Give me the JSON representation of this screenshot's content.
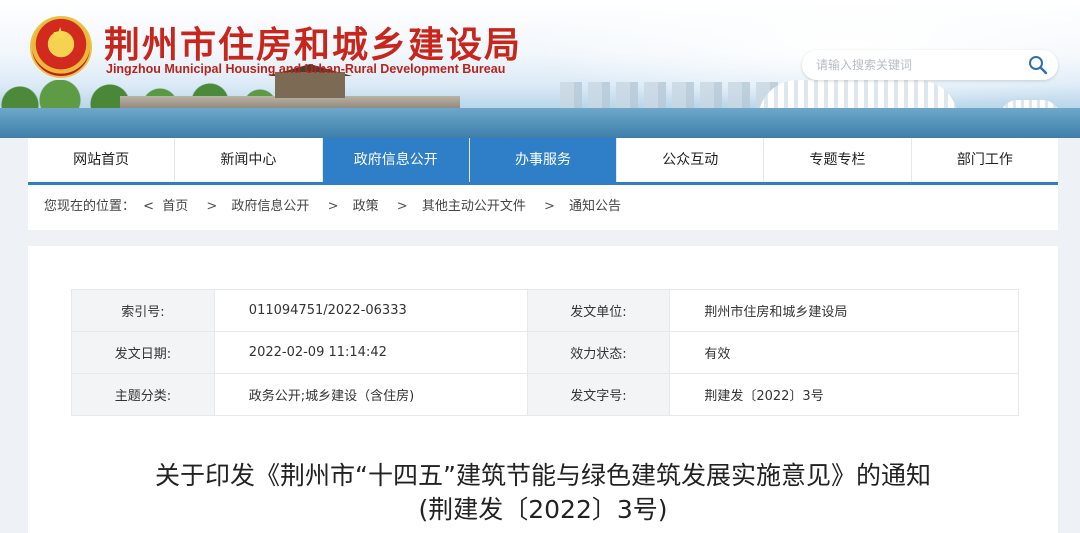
{
  "header": {
    "title_cn": "荆州市住房和城乡建设局",
    "title_en": "Jingzhou Municipal Housing and Urban-Rural Development Bureau",
    "emblem_icon": "national-emblem-icon",
    "search": {
      "placeholder": "请输入搜索关键词",
      "icon": "search-icon"
    }
  },
  "nav": {
    "items": [
      {
        "label": "网站首页",
        "active": false
      },
      {
        "label": "新闻中心",
        "active": false
      },
      {
        "label": "政府信息公开",
        "active": true
      },
      {
        "label": "办事服务",
        "active": true
      },
      {
        "label": "公众互动",
        "active": false
      },
      {
        "label": "专题专栏",
        "active": false
      },
      {
        "label": "部门工作",
        "active": false
      }
    ],
    "accent_color": "#2f7fc8"
  },
  "breadcrumb": {
    "prefix": "您现在的位置：",
    "lead_sep": "<",
    "separator": ">",
    "items": [
      "首页",
      "政府信息公开",
      "政策",
      "其他主动公开文件",
      "通知公告"
    ]
  },
  "meta": {
    "rows": [
      {
        "k1": "索引号:",
        "v1": "011094751/2022-06333",
        "k2": "发文单位:",
        "v2": "荆州市住房和城乡建设局"
      },
      {
        "k1": "发文日期:",
        "v1": "2022-02-09 11:14:42",
        "k2": "效力状态:",
        "v2": "有效"
      },
      {
        "k1": "主题分类:",
        "v1": "政务公开;城乡建设（含住房)",
        "k2": "发文字号:",
        "v2": "荆建发〔2022〕3号"
      }
    ]
  },
  "article": {
    "title_line1": "关于印发《荆州市“十四五”建筑节能与绿色建筑发展实施意见》的通知",
    "title_line2": "(荆建发〔2022〕3号)"
  }
}
